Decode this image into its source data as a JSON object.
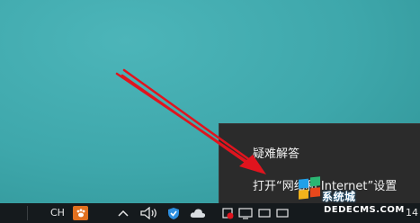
{
  "context_menu": {
    "items": [
      {
        "label": "疑难解答"
      },
      {
        "label": "打开“网络和 Internet”设置"
      }
    ]
  },
  "taskbar": {
    "language": "CH",
    "ime_icon": "paw-icon",
    "tray": {
      "show_hidden_icon": "chevron-up-icon",
      "volume_icon": "speaker-icon",
      "security_icon": "shield-icon",
      "cloud_icon": "cloud-icon",
      "network_icon": "network-icon"
    },
    "clock_partial": "14"
  },
  "watermark": {
    "line1": "系统城",
    "line2": "DEDECMS.COM"
  },
  "colors": {
    "desktop": "#41a9ad",
    "menu_bg": "#2b2b2b",
    "taskbar_bg": "#151a1d",
    "arrow": "#e0141e",
    "ime_orange": "#e1701f"
  }
}
